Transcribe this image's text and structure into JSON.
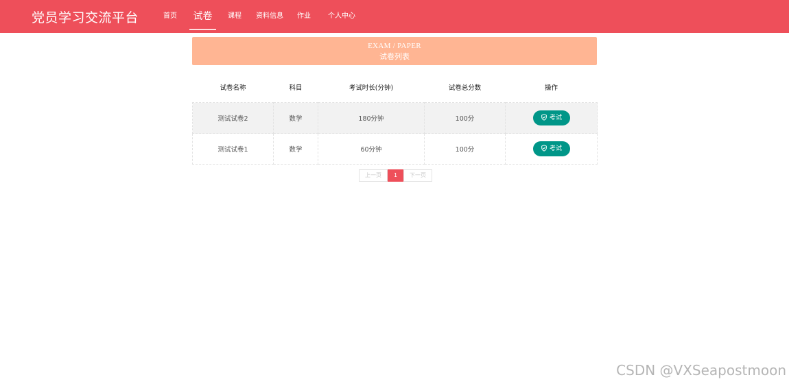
{
  "app": {
    "title": "党员学习交流平台"
  },
  "nav": {
    "items": [
      {
        "label": "首页"
      },
      {
        "label": "试卷"
      },
      {
        "label": "课程"
      },
      {
        "label": "资料信息"
      },
      {
        "label": "作业"
      },
      {
        "label": "个人中心"
      }
    ],
    "active": "试卷"
  },
  "banner": {
    "en": "EXAM / PAPER",
    "zh": "试卷列表"
  },
  "table": {
    "headers": [
      "试卷名称",
      "科目",
      "考试时长(分钟)",
      "试卷总分数",
      "操作"
    ],
    "rows": [
      {
        "name": "测试试卷2",
        "subject": "数学",
        "duration": "180分钟",
        "score": "100分",
        "action": "考试"
      },
      {
        "name": "测试试卷1",
        "subject": "数学",
        "duration": "60分钟",
        "score": "100分",
        "action": "考试"
      }
    ]
  },
  "pagination": {
    "prev": "上一页",
    "current": "1",
    "next": "下一页"
  },
  "watermark": "CSDN @VXSeapostmoon",
  "colors": {
    "header": "#ee4f5a",
    "banner": "#ffb593",
    "button": "#009688"
  },
  "icons": {
    "exam_button": "shield-check-icon"
  }
}
